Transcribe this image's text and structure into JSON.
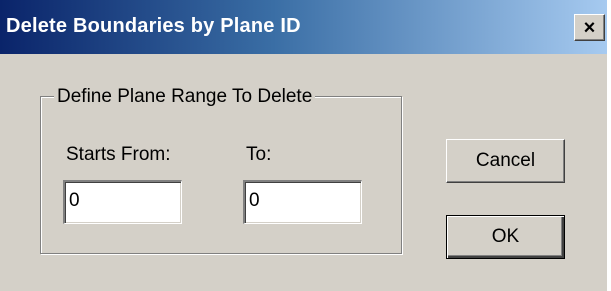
{
  "window": {
    "title": "Delete Boundaries by Plane ID",
    "close_label": "×"
  },
  "group": {
    "legend": "Define Plane Range To Delete",
    "starts_from_label": "Starts From:",
    "starts_from_value": "0",
    "to_label": "To:",
    "to_value": "0"
  },
  "buttons": {
    "cancel_label": "Cancel",
    "ok_label": "OK"
  },
  "colors": {
    "dialog_bg": "#d4d0c8",
    "titlebar_start": "#0a246a",
    "titlebar_end": "#a6caf0",
    "title_text": "#ffffff"
  }
}
